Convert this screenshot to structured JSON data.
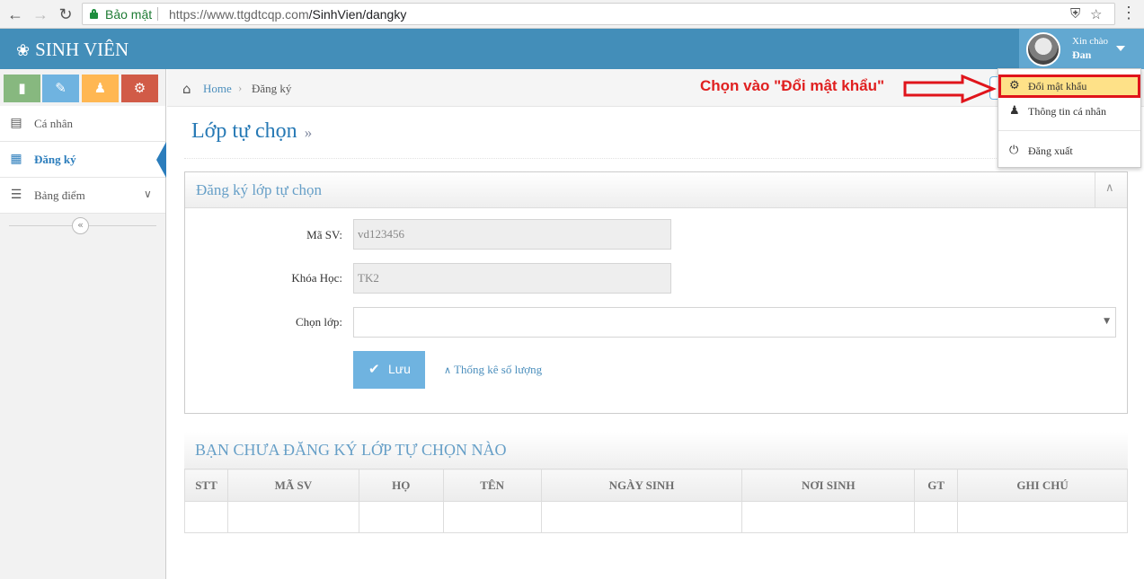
{
  "browser": {
    "secure_label": "Bảo mật",
    "url_host": "https://www.ttgdtcqp.com",
    "url_path": "/SinhVien/dangky"
  },
  "app": {
    "brand": "SINH VIÊN",
    "greeting": "Xin chào",
    "username": "Đan"
  },
  "colors": {
    "navbar": "#438eb9",
    "shortcut_1": "#87b87f",
    "shortcut_2": "#6fb3e0",
    "shortcut_3": "#ffb752",
    "shortcut_4": "#d15b47",
    "highlight": "#fee188",
    "annotation_red": "#e02020"
  },
  "sidebar": {
    "shortcuts": [
      {
        "icon": "signal-icon"
      },
      {
        "icon": "pencil-icon"
      },
      {
        "icon": "users-icon"
      },
      {
        "icon": "cogs-icon"
      }
    ],
    "items": [
      {
        "label": "Cá nhân",
        "icon": "list-alt-icon"
      },
      {
        "label": "Đăng ký",
        "icon": "calendar-icon",
        "active": true
      },
      {
        "label": "Bảng điểm",
        "icon": "list-icon"
      }
    ]
  },
  "breadcrumb": {
    "home": "Home",
    "current": "Đăng ký"
  },
  "annotation": {
    "text": "Chọn vào \"Đổi mật khẩu\""
  },
  "page": {
    "title": "Lớp tự chọn",
    "title_suffix": "»"
  },
  "form": {
    "header": "Đăng ký lớp tự chọn",
    "student_id_label": "Mã SV:",
    "student_id_value": "vd123456",
    "course_label": "Khóa Học:",
    "course_value": "TK2",
    "class_label": "Chọn lớp:",
    "class_value": "",
    "save_label": "Lưu",
    "stats_label": "Thống kê số lượng"
  },
  "table": {
    "title": "BẠN CHƯA ĐĂNG KÝ LỚP TỰ CHỌN NÀO",
    "columns": [
      "STT",
      "MÃ SV",
      "HỌ",
      "TÊN",
      "NGÀY SINH",
      "NƠI SINH",
      "GT",
      "GHI CHÚ"
    ]
  },
  "user_menu": {
    "items": [
      {
        "label": "Đổi mật khẩu",
        "icon": "cog-icon"
      },
      {
        "label": "Thông tin cá nhân",
        "icon": "user-icon"
      },
      {
        "label": "Đăng xuất",
        "icon": "power-off-icon"
      }
    ]
  }
}
